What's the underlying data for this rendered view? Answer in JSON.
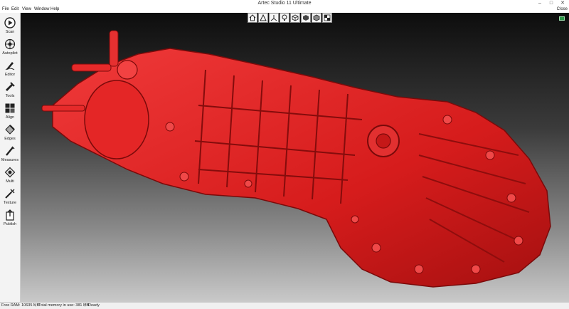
{
  "window": {
    "title": "Artec Studio 11 Ultimate",
    "controls": [
      "–",
      "□",
      "✕"
    ]
  },
  "menu": {
    "items": [
      "File",
      "Edit",
      "View",
      "Window",
      "Help"
    ],
    "close_label": "Close"
  },
  "sidebar": {
    "items": [
      {
        "label": "Scan",
        "icon": "play-circle-icon"
      },
      {
        "label": "Autopilot",
        "icon": "autopilot-icon"
      },
      {
        "label": "Editor",
        "icon": "editor-icon"
      },
      {
        "label": "Tools",
        "icon": "tools-icon"
      },
      {
        "label": "Align",
        "icon": "align-icon"
      },
      {
        "label": "Edges",
        "icon": "edges-icon"
      },
      {
        "label": "Measures",
        "icon": "measures-icon"
      },
      {
        "label": "Multi",
        "icon": "multi-icon"
      },
      {
        "label": "Texture",
        "icon": "texture-icon"
      },
      {
        "label": "Publish",
        "icon": "publish-icon"
      }
    ]
  },
  "viewport": {
    "model_color": "#e21f1f",
    "view_tools": [
      "home-view-icon",
      "grid-view-icon",
      "axes-view-icon",
      "light-icon",
      "box-view-icon",
      "solid-view-icon",
      "wire-view-icon",
      "texture-view-icon"
    ]
  },
  "status": {
    "free_ram": "Free RAM: 10635 MB",
    "total_memory": "Total memory in use: 381 MB",
    "state": "Ready"
  }
}
